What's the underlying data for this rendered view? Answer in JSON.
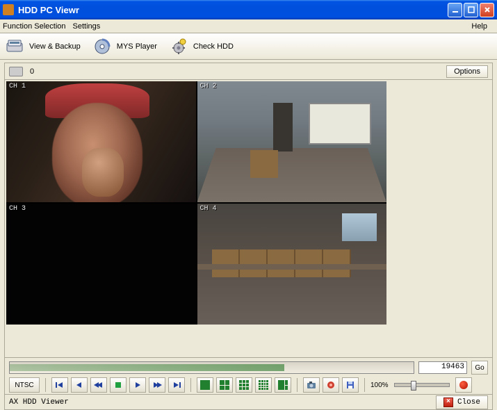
{
  "window": {
    "title": "HDD PC Viewr"
  },
  "menu": {
    "function": "Function Selection",
    "settings": "Settings",
    "help": "Help"
  },
  "toolbar": {
    "view_backup": "View & Backup",
    "mys_player": "MYS Player",
    "check_hdd": "Check HDD"
  },
  "strip": {
    "count": "0",
    "options": "Options"
  },
  "cameras": {
    "cam1": "CH 1",
    "cam2": "CH 2",
    "cam3": "CH 3",
    "cam4": "CH 4"
  },
  "seek": {
    "frame": "19463",
    "go": "Go",
    "format": "NTSC",
    "zoom_label": "100%"
  },
  "status": {
    "text": "AX HDD Viewer",
    "close": "Close"
  }
}
